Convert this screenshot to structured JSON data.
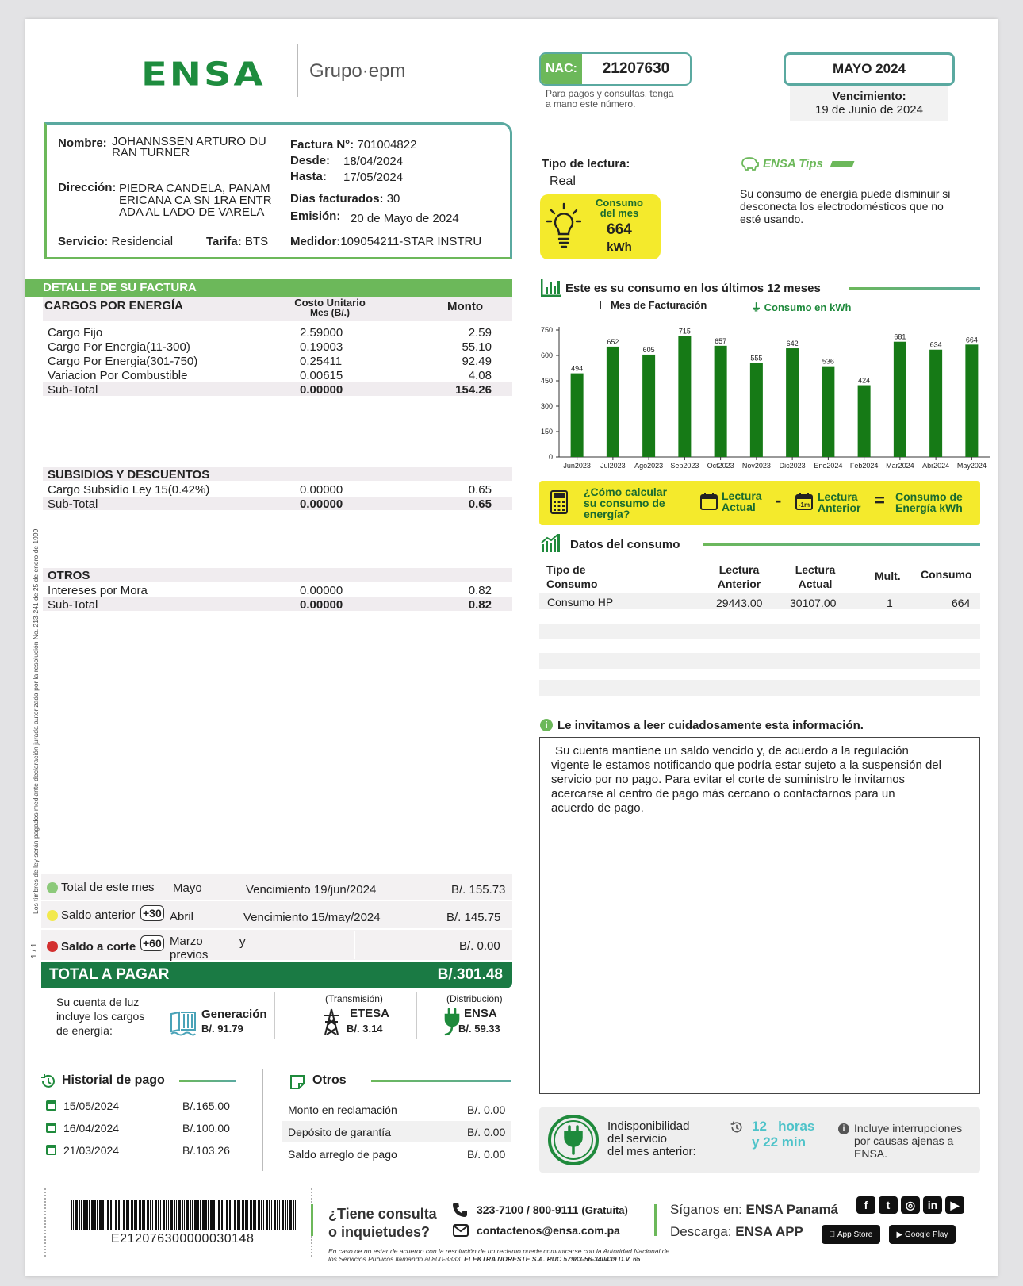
{
  "header": {
    "logo": "ENSA",
    "group": "Grupo·epm",
    "nac_label": "NAC:",
    "nac_value": "21207630",
    "nac_note1": "Para pagos y consultas, tenga",
    "nac_note2": "a mano este número.",
    "month": "MAYO 2024",
    "due_label": "Vencimiento:",
    "due_date": "19 de Junio de 2024"
  },
  "client": {
    "name_label": "Nombre:",
    "name1": "JOHANNSSEN ARTURO DU",
    "name2": "RAN TURNER",
    "address_label": "Dirección:",
    "address1": "PIEDRA CANDELA, PANAM",
    "address2": "ERICANA CA SN 1RA ENTR",
    "address3": "ADA AL LADO DE VARELA",
    "service_label": "Servicio:",
    "service": "Residencial",
    "tariff_label": "Tarifa:",
    "tariff": "BTS",
    "invoice_label": "Factura N°:",
    "invoice": "701004822",
    "from_label": "Desde:",
    "from": "18/04/2024",
    "to_label": "Hasta:",
    "to": "17/05/2024",
    "days_label": "Días facturados:",
    "days": "30",
    "issue_label": "Emisión:",
    "issue": "20 de Mayo de 2024",
    "meter_label": "Medidor:",
    "meter": "109054211-STAR INSTRU"
  },
  "reading": {
    "type_label": "Tipo de lectura:",
    "type": "Real",
    "consumo_l1": "Consumo",
    "consumo_l2": "del mes",
    "value": "664",
    "unit": "kWh"
  },
  "tips": {
    "title": "ENSA Tips",
    "text1": "Su consumo de energía puede disminuir si",
    "text2": "desconecta los electrodomésticos que no",
    "text3": "esté usando."
  },
  "detail": {
    "header": "DETALLE DE SU FACTURA",
    "energy_title": "CARGOS POR ENERGÍA",
    "col_unit1": "Costo Unitario",
    "col_unit2": "Mes (B/.)",
    "col_amount": "Monto",
    "energy_rows": [
      [
        "Cargo Fijo",
        "2.59000",
        "2.59"
      ],
      [
        "Cargo Por Energia(11-300)",
        "0.19003",
        "55.10"
      ],
      [
        "Cargo Por Energia(301-750)",
        "0.25411",
        "92.49"
      ],
      [
        "Variacion Por Combustible",
        "0.00615",
        "4.08"
      ]
    ],
    "energy_subtotal": [
      "Sub-Total",
      "0.00000",
      "154.26"
    ],
    "subsidy_title": "SUBSIDIOS Y DESCUENTOS",
    "subsidy_rows": [
      [
        "Cargo Subsidio Ley 15(0.42%)",
        "0.00000",
        "0.65"
      ]
    ],
    "subsidy_subtotal": [
      "Sub-Total",
      "0.00000",
      "0.65"
    ],
    "other_title": "OTROS",
    "other_rows": [
      [
        "Intereses por Mora",
        "0.00000",
        "0.82"
      ]
    ],
    "other_subtotal": [
      "Sub-Total",
      "0.00000",
      "0.82"
    ]
  },
  "side_note": "Los timbres de ley serán pagados mediante declaración jurada autorizada por la resolución No. 213-241 de 25 de enero de 1999.",
  "page_num": "1 / 1",
  "totals": {
    "r1_label": "Total de este mes",
    "r1_month": "Mayo",
    "r1_due": "Vencimiento 19/jun/2024",
    "r1_amount": "B/. 155.73",
    "r2_label": "Saldo anterior",
    "r2_badge": "+30",
    "r2_month": "Abril",
    "r2_due": "Vencimiento 15/may/2024",
    "r2_amount": "B/. 145.75",
    "r3_label": "Saldo a corte",
    "r3_badge": "+60",
    "r3_month1": "Marzo",
    "r3_y": "y",
    "r3_month2": "previos",
    "r3_amount": "B/. 0.00",
    "total_label": "TOTAL A PAGAR",
    "total_amount": "B/.301.48",
    "dot_colors": [
      "#8cc97a",
      "#f2e94c",
      "#d32f2f"
    ]
  },
  "charges": {
    "intro1": "Su cuenta de luz",
    "intro2": "incluye los cargos",
    "intro3": "de energía:",
    "gen_label": "Generación",
    "gen_value": "B/. 91.79",
    "trans_note": "(Transmisión)",
    "trans_label": "ETESA",
    "trans_value": "B/. 3.14",
    "dist_note": "(Distribución)",
    "dist_label": "ENSA",
    "dist_value": "B/. 59.33"
  },
  "history": {
    "title": "Historial de pago",
    "rows": [
      [
        "15/05/2024",
        "B/.165.00"
      ],
      [
        "16/04/2024",
        "B/.100.00"
      ],
      [
        "21/03/2024",
        "B/.103.26"
      ]
    ]
  },
  "others": {
    "title": "Otros",
    "rows": [
      [
        "Monto en reclamación",
        "B/. 0.00"
      ],
      [
        "Depósito de garantía",
        "B/. 0.00"
      ],
      [
        "Saldo arreglo de pago",
        "B/. 0.00"
      ]
    ]
  },
  "chart_title": "Este es su consumo en los últimos 12 meses",
  "chart_legend_x": "Mes de Facturación",
  "chart_legend_y": "Consumo en kWh",
  "chart_data": {
    "type": "bar",
    "categories": [
      "Jun2023",
      "Jul2023",
      "Ago2023",
      "Sep2023",
      "Oct2023",
      "Nov2023",
      "Dic2023",
      "Ene2024",
      "Feb2024",
      "Mar2024",
      "Abr2024",
      "May2024"
    ],
    "values": [
      494,
      652,
      605,
      715,
      657,
      555,
      642,
      536,
      424,
      681,
      634,
      664
    ],
    "ylim": [
      0,
      750
    ],
    "yticks": [
      0,
      150,
      300,
      450,
      600,
      750
    ],
    "color": "#167a16"
  },
  "calc": {
    "q1": "¿Cómo calcular",
    "q2": "su consumo de",
    "q3": "energía?",
    "a1": "Lectura",
    "a2": "Actual",
    "minus": "-",
    "b1": "Lectura",
    "b2": "Anterior",
    "eq": "=",
    "c1": "Consumo de",
    "c2": "Energía kWh",
    "badge": "-1m"
  },
  "consumo": {
    "title": "Datos del consumo",
    "h1a": "Tipo de",
    "h1b": "Consumo",
    "h2a": "Lectura",
    "h2b": "Anterior",
    "h3a": "Lectura",
    "h3b": "Actual",
    "h4": "Mult.",
    "h5": "Consumo",
    "row": [
      "Consumo HP",
      "29443.00",
      "30107.00",
      "1",
      "664"
    ]
  },
  "info": {
    "title": "Le invitamos a leer cuidadosamente esta información.",
    "l1": "Su cuenta mantiene un saldo vencido y, de acuerdo a la regulación",
    "l2": "vigente le estamos notificando que podría estar sujeto a la suspensión del",
    "l3": "servicio por no pago. Para evitar el corte de suministro le invitamos",
    "l4": "acercarse al centro de pago más cercano o contactarnos para un",
    "l5": "acuerdo de pago."
  },
  "unavail": {
    "l1": "Indisponibilidad",
    "l2": "del servicio",
    "l3": "del mes anterior:",
    "time1": "12   horas",
    "time2": "y 22 min",
    "n1": "Incluye interrupciones",
    "n2": "por causas ajenas a",
    "n3": "ENSA."
  },
  "footer": {
    "barcode": "E212076300000030148",
    "q1": "¿Tiene consulta",
    "q2": "o inquietudes?",
    "phone": "323-7100 / 800-9111",
    "phone_note": "(Gratuita)",
    "email": "contactenos@ensa.com.pa",
    "follow_label": "Síganos en:",
    "follow_name": "ENSA Panamá",
    "download_label": "Descarga:",
    "download_name": "ENSA APP",
    "appstore": "App Store",
    "googleplay": "Google Play",
    "legal1": "En caso de no estar de acuerdo con la resolución de un reclamo puede comunicarse con la Autoridad Nacional de",
    "legal2a": "los Servicios Públicos llamando al 800-3333.",
    "legal2b": "ELEKTRA NORESTE S.A. RUC 57983-56-340439 D.V. 65"
  }
}
